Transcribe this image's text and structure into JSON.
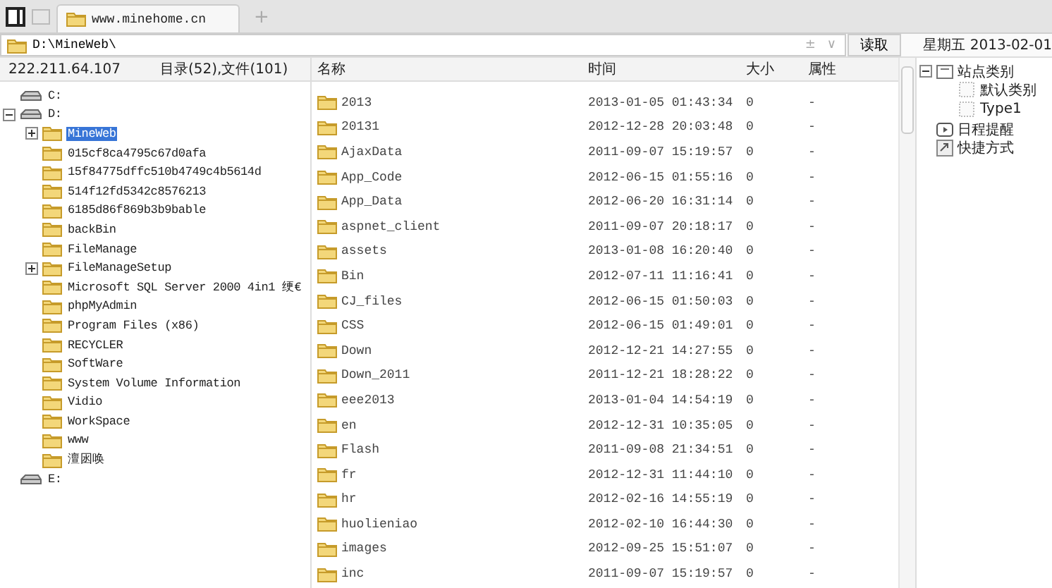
{
  "tabs": [
    {
      "label": "www.minehome.cn",
      "selected": true
    }
  ],
  "new_tab": "+",
  "address": {
    "value": "D:\\MineWeb\\",
    "add_glyph": "±",
    "dropdown_glyph": "∨",
    "read_button": "读取"
  },
  "date": "星期五 2013-02-01",
  "info": {
    "ip": "222.211.64.107",
    "counts": "目录(52),文件(101)"
  },
  "columns": [
    "名称",
    "时间",
    "大小",
    "属性"
  ],
  "tree": [
    {
      "label": "C:",
      "kind": "drive"
    },
    {
      "label": "D:",
      "kind": "drive",
      "expanded": true,
      "children": [
        {
          "label": "MineWeb",
          "kind": "folder",
          "expanded": false,
          "selected": true
        },
        {
          "label": "015cf8ca4795c67d0afa",
          "kind": "folder",
          "selected": false
        },
        {
          "label": "15f84775dffc510b4749c4b5614d",
          "kind": "folder",
          "selected": false
        },
        {
          "label": "514f12fd5342c8576213",
          "kind": "folder",
          "selected": false
        },
        {
          "label": "6185d86f869b3b9bable",
          "kind": "folder",
          "selected": false
        },
        {
          "label": "backBin",
          "kind": "folder",
          "selected": false
        },
        {
          "label": "FileManage",
          "kind": "folder",
          "selected": false
        },
        {
          "label": "FileManageSetup",
          "kind": "folder",
          "expanded": false,
          "selected": false
        },
        {
          "label": "Microsoft SQL Server 2000  4in1  绠€",
          "kind": "folder",
          "selected": false
        },
        {
          "label": "phpMyAdmin",
          "kind": "folder",
          "selected": false
        },
        {
          "label": "Program Files (x86)",
          "kind": "folder",
          "selected": false
        },
        {
          "label": "RECYCLER",
          "kind": "folder",
          "selected": false
        },
        {
          "label": "SoftWare",
          "kind": "folder",
          "selected": false
        },
        {
          "label": "System Volume Information",
          "kind": "folder",
          "selected": false
        },
        {
          "label": "Vidio",
          "kind": "folder",
          "selected": false
        },
        {
          "label": "WorkSpace",
          "kind": "folder",
          "selected": false
        },
        {
          "label": "www",
          "kind": "folder",
          "selected": false
        },
        {
          "label": "澶囦唤",
          "kind": "folder",
          "selected": false
        }
      ]
    },
    {
      "label": "E:",
      "kind": "drive"
    }
  ],
  "files": [
    {
      "name": "2013",
      "time": "2013-01-05 01:43:34",
      "size": "0",
      "attr": "-"
    },
    {
      "name": "20131",
      "time": "2012-12-28 20:03:48",
      "size": "0",
      "attr": "-"
    },
    {
      "name": "AjaxData",
      "time": "2011-09-07 15:19:57",
      "size": "0",
      "attr": "-"
    },
    {
      "name": "App_Code",
      "time": "2012-06-15 01:55:16",
      "size": "0",
      "attr": "-"
    },
    {
      "name": "App_Data",
      "time": "2012-06-20 16:31:14",
      "size": "0",
      "attr": "-"
    },
    {
      "name": "aspnet_client",
      "time": "2011-09-07 20:18:17",
      "size": "0",
      "attr": "-"
    },
    {
      "name": "assets",
      "time": "2013-01-08 16:20:40",
      "size": "0",
      "attr": "-"
    },
    {
      "name": "Bin",
      "time": "2012-07-11 11:16:41",
      "size": "0",
      "attr": "-"
    },
    {
      "name": "CJ_files",
      "time": "2012-06-15 01:50:03",
      "size": "0",
      "attr": "-"
    },
    {
      "name": "CSS",
      "time": "2012-06-15 01:49:01",
      "size": "0",
      "attr": "-"
    },
    {
      "name": "Down",
      "time": "2012-12-21 14:27:55",
      "size": "0",
      "attr": "-"
    },
    {
      "name": "Down_2011",
      "time": "2011-12-21 18:28:22",
      "size": "0",
      "attr": "-"
    },
    {
      "name": "eee2013",
      "time": "2013-01-04 14:54:19",
      "size": "0",
      "attr": "-"
    },
    {
      "name": "en",
      "time": "2012-12-31 10:35:05",
      "size": "0",
      "attr": "-"
    },
    {
      "name": "Flash",
      "time": "2011-09-08 21:34:51",
      "size": "0",
      "attr": "-"
    },
    {
      "name": "fr",
      "time": "2012-12-31 11:44:10",
      "size": "0",
      "attr": "-"
    },
    {
      "name": "hr",
      "time": "2012-02-16 14:55:19",
      "size": "0",
      "attr": "-"
    },
    {
      "name": "huolieniao",
      "time": "2012-02-10 16:44:30",
      "size": "0",
      "attr": "-"
    },
    {
      "name": "images",
      "time": "2012-09-25 15:51:07",
      "size": "0",
      "attr": "-"
    },
    {
      "name": "inc",
      "time": "2011-09-07 15:19:57",
      "size": "0",
      "attr": "-"
    }
  ],
  "side_tree": [
    {
      "label": "站点类别",
      "kind": "category",
      "expanded": true,
      "children": [
        {
          "label": "默认类别",
          "kind": "item"
        },
        {
          "label": "Type1",
          "kind": "item"
        }
      ]
    },
    {
      "label": "日程提醒",
      "kind": "schedule"
    },
    {
      "label": "快捷方式",
      "kind": "shortcut"
    }
  ]
}
